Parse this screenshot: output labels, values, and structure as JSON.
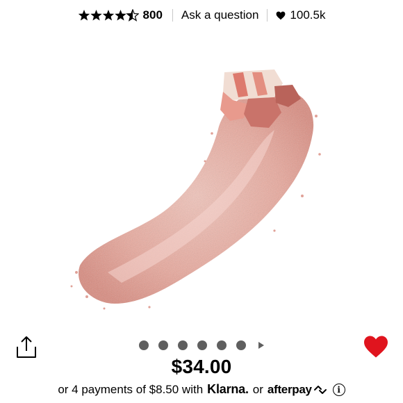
{
  "header": {
    "rating_value": 4.5,
    "rating_max": 5,
    "review_count": "800",
    "ask_question_label": "Ask a question",
    "loves_count": "100.5k"
  },
  "product_image": {
    "icon": "blush-powder-swatch-image",
    "colors": {
      "base": "#e8a398",
      "light": "#f3c9bf",
      "dark": "#c9736a"
    }
  },
  "carousel": {
    "dot_count": 6,
    "active_index": 0,
    "has_next_arrow": true
  },
  "actions": {
    "share_icon": "share-icon",
    "love_icon": "heart-icon",
    "love_color": "#e0141e"
  },
  "price": {
    "amount": "$34.00"
  },
  "installments": {
    "prefix": "or 4 payments of $8.50 with",
    "klarna_label": "Klarna.",
    "or_label": "or",
    "afterpay_label": "afterpay",
    "info_icon": "info-icon"
  }
}
